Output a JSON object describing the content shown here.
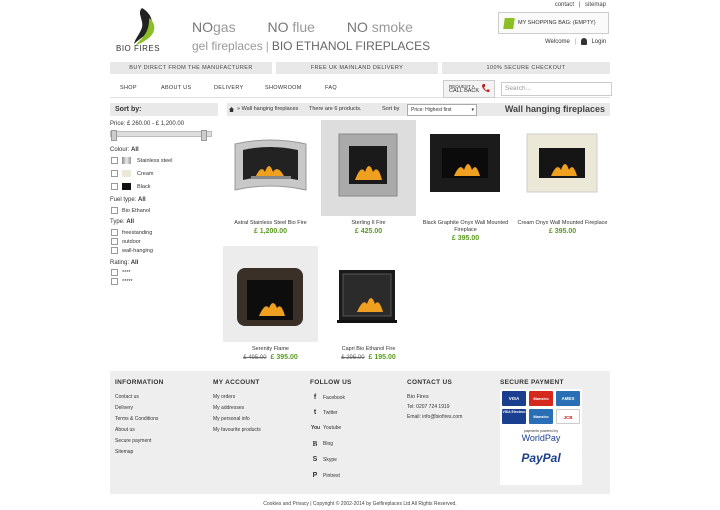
{
  "header": {
    "top_links": [
      "contact",
      "sitemap"
    ],
    "logo_text": "BIO FIRES",
    "no_items": [
      {
        "no": "NO",
        "word": "gas"
      },
      {
        "no": "NO",
        "word": "flue"
      },
      {
        "no": "NO",
        "word": "smoke"
      }
    ],
    "tagline_left": "gel fireplaces",
    "tagline_right": "BIO ETHANOL FIREPLACES",
    "bag_label": "MY SHOPPING BAG: (EMPTY)",
    "welcome": "Welcome",
    "login": "Login"
  },
  "usp": [
    "BUY DIRECT FROM THE MANUFACTURER",
    "FREE UK MAINLAND DELIVERY",
    "100% SECURE CHECKOUT"
  ],
  "nav": {
    "items": [
      "SHOP",
      "ABOUT US",
      "DELIVERY",
      "SHOWROOM",
      "FAQ"
    ],
    "callback_line1": "REQUEST A",
    "callback_line2": "CALL BACK",
    "search_placeholder": "Search..."
  },
  "sidebar": {
    "sort_heading": "Sort by:",
    "price_label": "Price: £ 260.00 - £ 1,200.00",
    "price_range": {
      "min": 260,
      "max": 1200,
      "selected_min": 260,
      "selected_max": 1200
    },
    "colour_label": "Colour:",
    "colour_value": "All",
    "colours": [
      {
        "name": "Stainless steel",
        "swatch": "#b8b8b8"
      },
      {
        "name": "Cream",
        "swatch": "#ece8d8"
      },
      {
        "name": "Black",
        "swatch": "#111111"
      }
    ],
    "fuel_label": "Fuel type:",
    "fuel_value": "All",
    "fuels": [
      "Bio Ethanol"
    ],
    "type_label": "Type:",
    "type_value": "All",
    "types": [
      "freestanding",
      "outdoor",
      "wall-hanging"
    ],
    "rating_label": "Rating:",
    "rating_value": "All",
    "ratings": [
      "****",
      "*****"
    ]
  },
  "content": {
    "breadcrumb_sep": "»",
    "breadcrumb": "Wall hanging fireplaces",
    "count": "There are 6 products.",
    "sort_label": "Sort by",
    "sort_value": "Price: Highest first",
    "title": "Wall hanging fireplaces",
    "products": [
      {
        "name": "Astral Stainless Steel Bio Fire",
        "price": "£ 1,200.00",
        "old_price": ""
      },
      {
        "name": "Sterling II Fire",
        "price": "£ 425.00",
        "old_price": ""
      },
      {
        "name": "Black Graphite Onyx Wall Mounted Fireplace",
        "price": "£ 395.00",
        "old_price": ""
      },
      {
        "name": "Cream Onyx Wall Mounted Fireplace",
        "price": "£ 395.00",
        "old_price": ""
      },
      {
        "name": "Serenity Flame",
        "price": "£ 395.00",
        "old_price": "£ 495.00"
      },
      {
        "name": "Capri Bio Ethanol Fire",
        "price": "£ 195.00",
        "old_price": "£ 295.00"
      }
    ]
  },
  "footer": {
    "information": {
      "title": "INFORMATION",
      "links": [
        "Contact us",
        "Delivery",
        "Terms & Conditions",
        "About us",
        "Secure payment",
        "Sitemap"
      ]
    },
    "account": {
      "title": "MY ACCOUNT",
      "links": [
        "My orders",
        "My addresses",
        "My personal info",
        "My favourite products"
      ]
    },
    "follow": {
      "title": "FOLLOW US",
      "links": [
        "Facebook",
        "Twitter",
        "Youtube",
        "Blog",
        "Skype",
        "Pintrest"
      ]
    },
    "contact": {
      "title": "CONTACT US",
      "lines": [
        "Bio Fires",
        "Tel: 0207 724 1919",
        "Email: info@biofires.com"
      ]
    },
    "payment": {
      "title": "SECURE PAYMENT",
      "cards": [
        "VISA",
        "Maestro",
        "AMEX",
        "VISA Electron",
        "Maestro",
        "JCB"
      ],
      "powered": "payments powered by",
      "worldpay": "WorldPay",
      "paypal": "PayPal"
    },
    "copyright": "Cookies and Privacy | Copyright © 2002-2014 by Gelfireplaces Ltd All Rights Reserved."
  }
}
